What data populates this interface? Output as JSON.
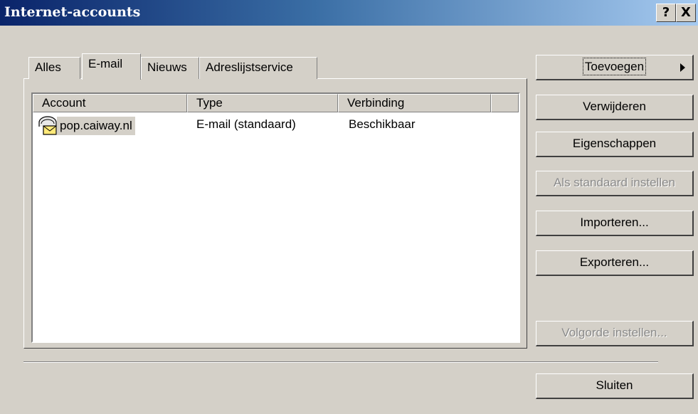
{
  "window": {
    "title": "Internet-accounts",
    "help_label": "?",
    "close_label": "X"
  },
  "tabs": [
    {
      "label": "Alles",
      "active": false
    },
    {
      "label": "E-mail",
      "active": true
    },
    {
      "label": "Nieuws",
      "active": false
    },
    {
      "label": "Adreslijstservice",
      "active": false
    }
  ],
  "list": {
    "columns": [
      "Account",
      "Type",
      "Verbinding"
    ],
    "rows": [
      {
        "account": "pop.caiway.nl",
        "type": "E-mail (standaard)",
        "connection": "Beschikbaar",
        "icon": "mail-account-icon",
        "selected": true
      }
    ]
  },
  "buttons": {
    "add": "Toevoegen",
    "remove": "Verwijderen",
    "properties": "Eigenschappen",
    "set_default": "Als standaard instellen",
    "import": "Importeren...",
    "export": "Exporteren...",
    "order": "Volgorde instellen...",
    "close": "Sluiten"
  },
  "colors": {
    "title_start": "#0a246a",
    "title_end": "#a6caf0",
    "face": "#d4d0c8"
  }
}
